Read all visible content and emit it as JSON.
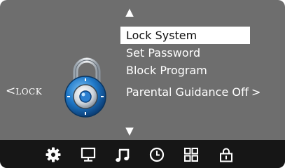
{
  "menu": {
    "items": [
      {
        "label": "Lock System"
      },
      {
        "label": "Set Password"
      },
      {
        "label": "Block Program"
      }
    ],
    "selected_index": 0,
    "guidance_label": "Parental Guidance Off",
    "guidance_arrow": ">"
  },
  "scroll": {
    "up": "▲",
    "down": "▼"
  },
  "lock_nav": {
    "arrow": "<",
    "label": "LOCK"
  },
  "tabs": [
    {
      "icon": "settings-gear-icon",
      "active": true
    },
    {
      "icon": "monitor-icon",
      "active": false
    },
    {
      "icon": "music-note-icon",
      "active": false
    },
    {
      "icon": "clock-icon",
      "active": false
    },
    {
      "icon": "grid-icon",
      "active": false
    },
    {
      "icon": "padlock-icon",
      "active": false
    }
  ],
  "colors": {
    "background": "#6e6e6e",
    "bottom_bar": "#161616",
    "highlight": "#ffffff",
    "lock_blue": "#1f78c8"
  }
}
